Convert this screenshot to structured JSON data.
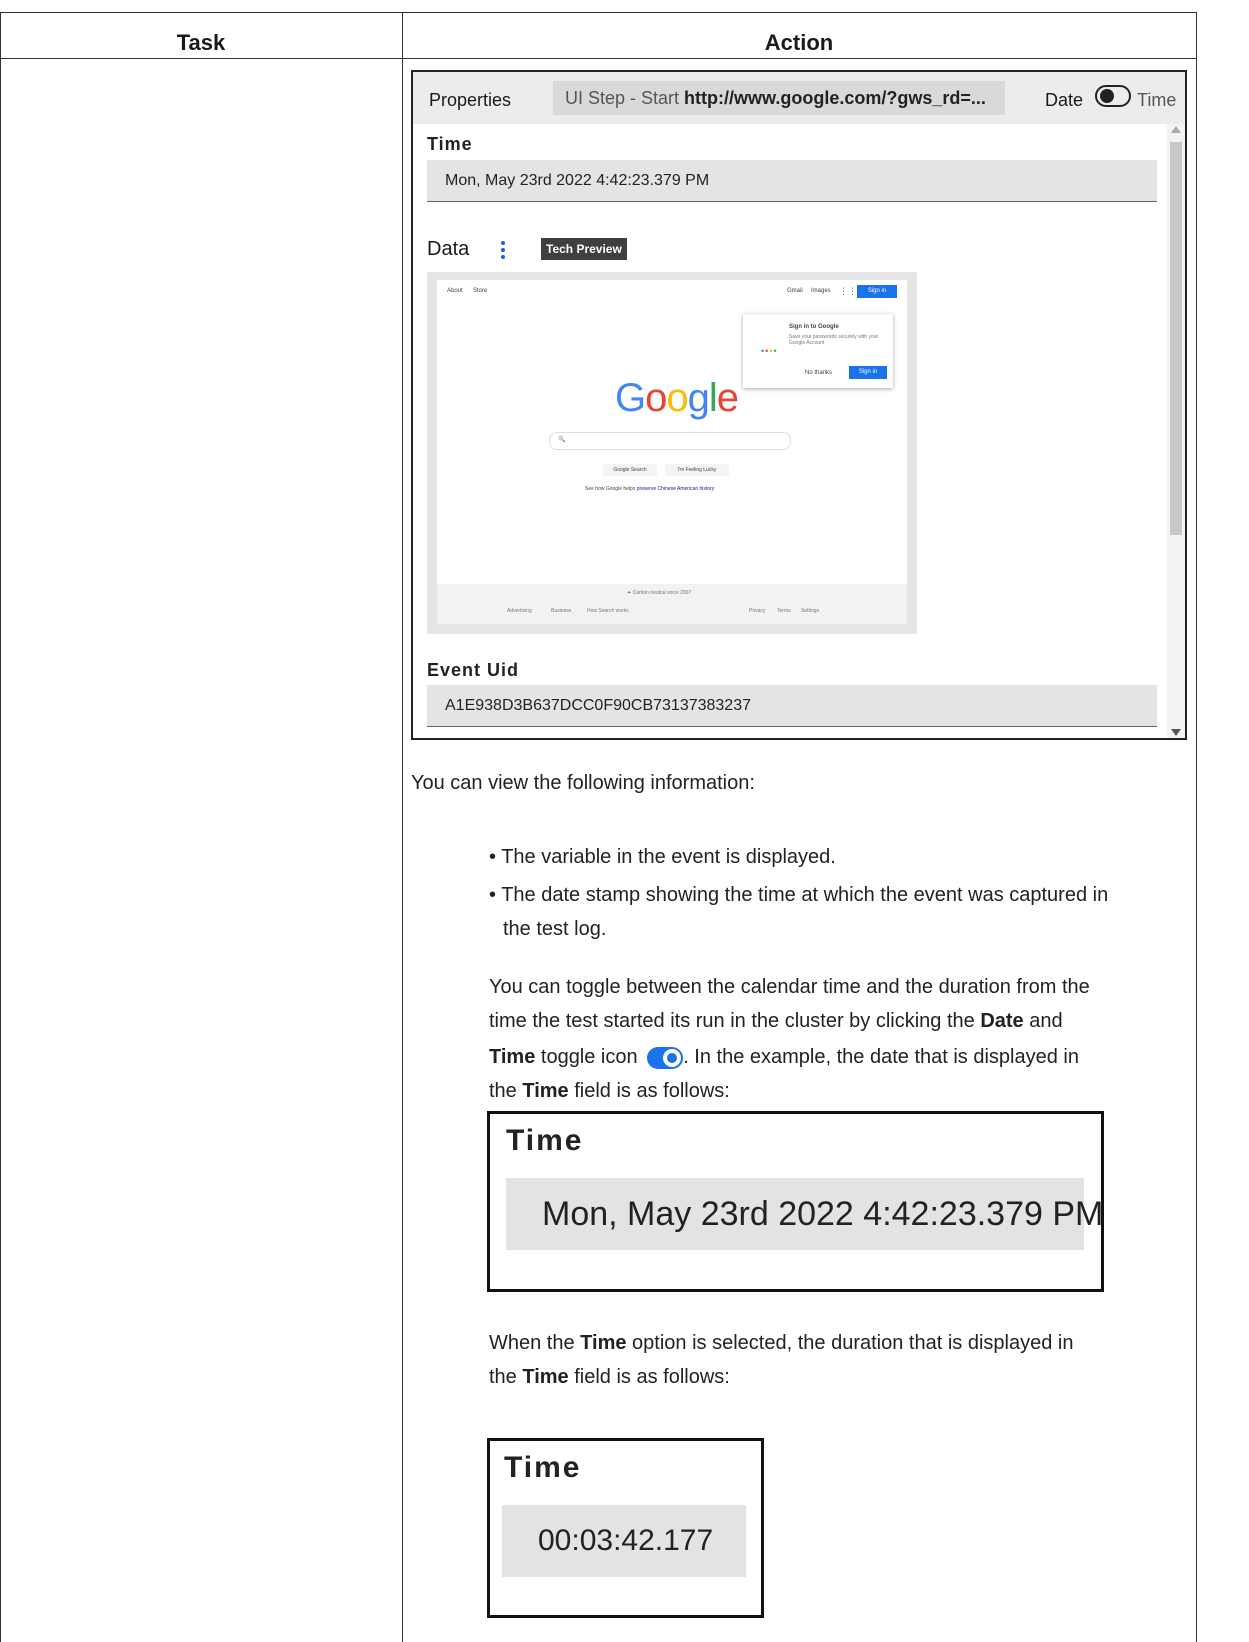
{
  "table": {
    "col_task": "Task",
    "col_action": "Action"
  },
  "panel": {
    "properties_label": "Properties",
    "step_prefix": "UI Step - Start ",
    "step_url": "http://www.google.com/?gws_rd=...",
    "toggle_date": "Date",
    "toggle_time": "Time",
    "time_label": "Time",
    "time_value": "Mon, May 23rd 2022 4:42:23.379 PM",
    "data_label": "Data",
    "tech_preview": "Tech Preview",
    "event_uid_label": "Event Uid",
    "event_uid_value": "A1E938D3B637DCC0F90CB73137383237"
  },
  "google_shot": {
    "top_left": [
      "About",
      "Store"
    ],
    "top_right": [
      "Gmail",
      "Images"
    ],
    "sign_in": "Sign in",
    "popup_title": "Sign in to Google",
    "popup_text": "Save your passwords securely with your Google Account",
    "popup_no": "No thanks",
    "popup_yes": "Sign in",
    "search_btn": "Google Search",
    "lucky_btn": "I'm Feeling Lucky",
    "promo_prefix": "See how Google helps ",
    "promo_link": "preserve Chinese American history",
    "carbon": "Carbon neutral since 2007",
    "footer_left": [
      "Advertising",
      "Business",
      "How Search works"
    ],
    "footer_right": [
      "Privacy",
      "Terms",
      "Settings"
    ]
  },
  "body": {
    "intro": "You can view the following information:",
    "bullet1": "The variable in the event is displayed.",
    "bullet2_line1": "The date stamp showing the time at which the event was captured in",
    "bullet2_line2": "the test log.",
    "para1_line1": "You can toggle between the calendar time and the duration from the",
    "para1_line2a": "time the test started its run in the cluster by clicking the ",
    "para1_date": "Date",
    "para1_and": " and",
    "para1_time": "Time",
    "para1_line3a": " toggle icon ",
    "para1_line3b": ". In the example, the date that is displayed in",
    "para1_line4a": "the ",
    "para1_line4b": "Time",
    "para1_line4c": " field is as follows:",
    "zoom1_label": "Time",
    "zoom1_value": "Mon, May 23rd 2022 4:42:23.379 PM",
    "para2_line1a": "When the ",
    "para2_time": "Time",
    "para2_line1b": " option is selected, the duration that is displayed in",
    "para2_line2a": "the ",
    "para2_time2": "Time",
    "para2_line2b": " field is as follows:",
    "zoom2_label": "Time",
    "zoom2_value": "00:03:42.177"
  }
}
